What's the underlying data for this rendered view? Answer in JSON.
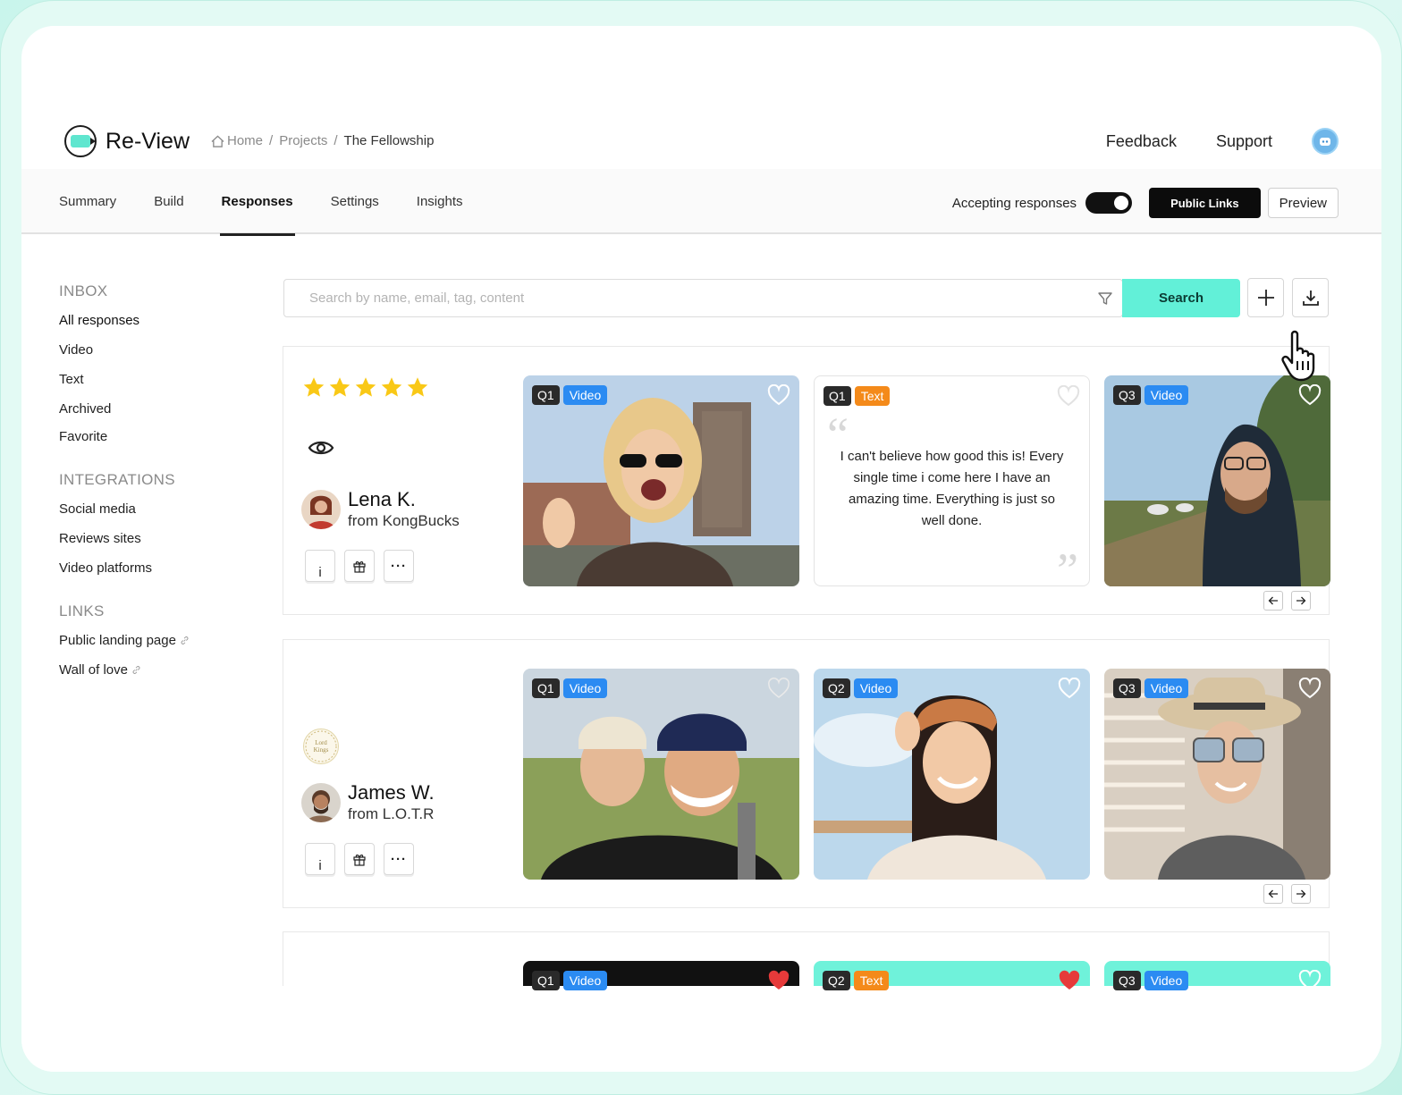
{
  "app": {
    "name": "Re-View"
  },
  "breadcrumb": {
    "home": "Home",
    "projects": "Projects",
    "current": "The Fellowship",
    "sep": "/"
  },
  "topnav": {
    "feedback": "Feedback",
    "support": "Support"
  },
  "tabs": [
    "Summary",
    "Build",
    "Responses",
    "Settings",
    "Insights"
  ],
  "active_tab": "Responses",
  "controls": {
    "accepting_label": "Accepting responses",
    "accepting_on": true,
    "public_links": "Public Links",
    "preview": "Preview"
  },
  "sidebar": {
    "inbox_title": "INBOX",
    "inbox": [
      "All responses",
      "Video",
      "Text",
      "Archived",
      "Favorite"
    ],
    "integrations_title": "INTEGRATIONS",
    "integrations": [
      "Social media",
      "Reviews sites",
      "Video platforms"
    ],
    "links_title": "LINKS",
    "links": [
      "Public landing page",
      "Wall of love"
    ]
  },
  "search": {
    "placeholder": "Search by name, email, tag, content",
    "button": "Search"
  },
  "responses": [
    {
      "name": "Lena K.",
      "from": "from KongBucks",
      "rating": 5,
      "items": [
        {
          "q": "Q1",
          "type": "Video"
        },
        {
          "q": "Q1",
          "type": "Text",
          "text": "I can't believe how good this is! Every single time i come here I have an amazing time. Everything is just so well done."
        },
        {
          "q": "Q3",
          "type": "Video"
        }
      ]
    },
    {
      "name": "James W.",
      "from": "from L.O.T.R",
      "company_logo": "Lord Kings",
      "items": [
        {
          "q": "Q1",
          "type": "Video"
        },
        {
          "q": "Q2",
          "type": "Video"
        },
        {
          "q": "Q3",
          "type": "Video"
        }
      ]
    },
    {
      "items": [
        {
          "q": "Q1",
          "type": "Video"
        },
        {
          "q": "Q2",
          "type": "Text"
        },
        {
          "q": "Q3",
          "type": "Video"
        }
      ]
    }
  ],
  "actions": {
    "info": "i",
    "more": "···"
  },
  "colors": {
    "accent": "#62f0d8",
    "video_badge": "#2b8bf2",
    "text_badge": "#f48a1a",
    "star": "#f9c816",
    "heart_active": "#e63a3a"
  }
}
